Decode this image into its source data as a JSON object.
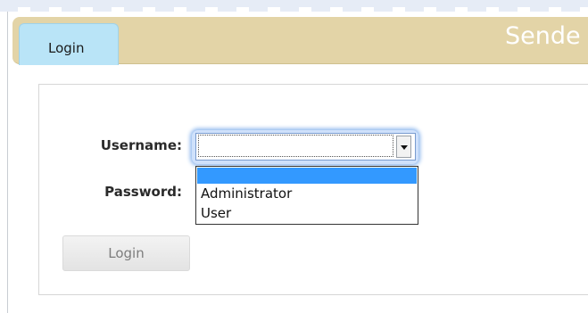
{
  "header": {
    "tab_label": "Login",
    "brand_partial": "Sende"
  },
  "form": {
    "username_label": "Username:",
    "password_label": "Password:",
    "username_select": {
      "selected": "",
      "options": [
        "",
        "Administrator",
        "User"
      ]
    },
    "login_button": "Login"
  },
  "colors": {
    "header_bg": "#e3d4a7",
    "tab_bg": "#b9e4f7",
    "highlight": "#3399ff",
    "focus_glow": "#8fb8ee"
  }
}
